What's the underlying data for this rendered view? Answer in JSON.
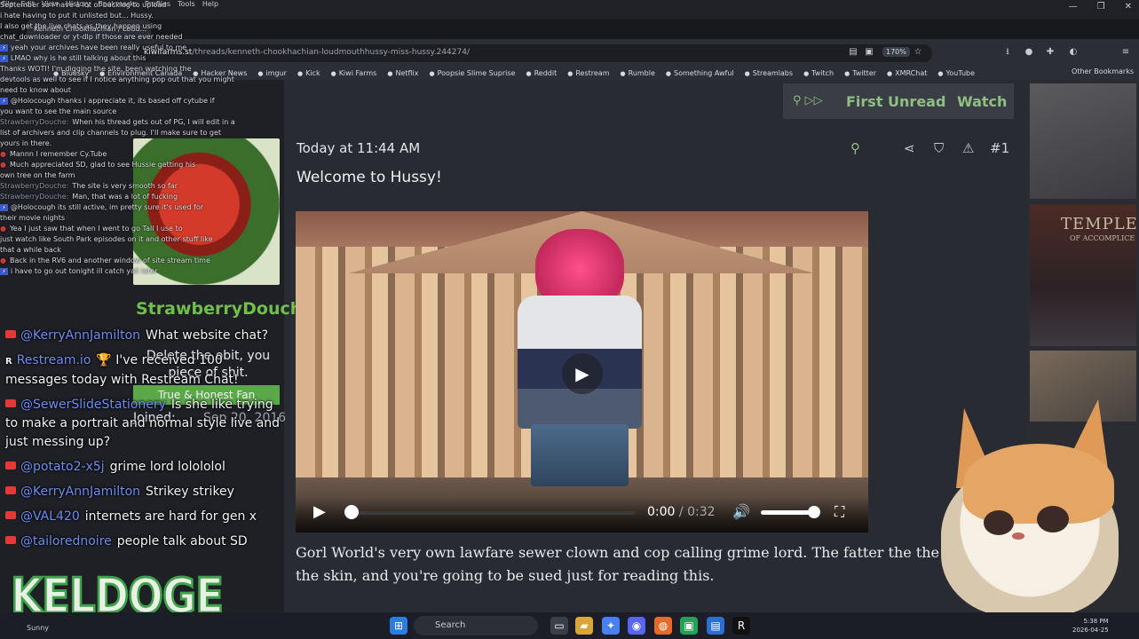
{
  "browser": {
    "menu": [
      "File",
      "Edit",
      "View",
      "History",
      "Bookmarks",
      "Profiles",
      "Tools",
      "Help"
    ],
    "tab_title": "Kenneth Chookhachian / Loud...",
    "url_host": "kiwifarms.st",
    "url_path": "/threads/kenneth-chookhachian-loudmouthhussy-miss-hussy.244274/",
    "zoom": "170%",
    "bookmarks": [
      "Bluesky",
      "Environment Canada",
      "Hacker News",
      "imgur",
      "Kick",
      "Kiwi Farms",
      "Netflix",
      "Poopsie Slime Suprise",
      "Reddit",
      "Restream",
      "Rumble",
      "Something Awful",
      "Streamlabs",
      "Twitch",
      "Twitter",
      "XMRChat",
      "YouTube"
    ],
    "other_bookmarks": "Other Bookmarks"
  },
  "thread_bar": {
    "first_unread": "First Unread",
    "watch": "Watch"
  },
  "post": {
    "username": "StrawberryDouche",
    "user_title": "Delete the obit, you piece of shit.",
    "badge": "True & Honest Fan",
    "joined_label": "Joined:",
    "joined_value": "Sep 20, 2016",
    "time": "Today at 11:44 AM",
    "number": "#1",
    "title": "Welcome to Hussy!",
    "body": "Gorl World's very own lawfare sewer clown and cop calling grime lord. The fatter the the thinner the skin, and you're going to be sued just for reading this."
  },
  "video": {
    "current": "0:00",
    "separator": "/",
    "duration": "0:32"
  },
  "chat_top": [
    {
      "who": "",
      "text": "September so i have a lot of backlog to upload"
    },
    {
      "who": "",
      "text": "i hate having to put it unlisted but... Hussy."
    },
    {
      "who": "",
      "text": "I also get the live chats as they happen using"
    },
    {
      "who": "",
      "text": "chat_downloader or yt-dlp if those are ever needed"
    },
    {
      "who": "mod",
      "text": "yeah your archives have been really useful to me"
    },
    {
      "who": "mod",
      "text": "LMAO why is he still talking about this"
    },
    {
      "who": "",
      "text": "Thanks WOTI! I'm digging the site, been watching the"
    },
    {
      "who": "",
      "text": "devtools as well to see if I notice anything pop out that you might"
    },
    {
      "who": "",
      "text": "need to know about"
    },
    {
      "who": "mod",
      "text": "@Holocough thanks i appreciate it, its based off cytube if"
    },
    {
      "who": "",
      "text": "you want to see the main source"
    },
    {
      "who": "StrawberryDouche:",
      "text": "When his thread gets out of PG, I will edit in a"
    },
    {
      "who": "",
      "text": "list of archivers and clip channels to plug. I'll make sure to get"
    },
    {
      "who": "",
      "text": "yours in there."
    },
    {
      "who": "red",
      "text": "Mannn I remember Cy.Tube"
    },
    {
      "who": "red",
      "text": "Much appreciated SD, glad to see Hussie getting his"
    },
    {
      "who": "",
      "text": "own tree on the farm"
    },
    {
      "who": "StrawberryDouche:",
      "text": "The site is very smooth so far"
    },
    {
      "who": "StrawberryDouche:",
      "text": "Man, that was a lot of fucking"
    },
    {
      "who": "mod",
      "text": "@Holocough its still active, im pretty sure it's used for"
    },
    {
      "who": "",
      "text": "their movie nights"
    },
    {
      "who": "red",
      "text": "Yea I just saw that when I went to go Tall I use to"
    },
    {
      "who": "",
      "text": "just watch like South Park episodes on it and other stuff like"
    },
    {
      "who": "",
      "text": "that a while back"
    },
    {
      "who": "red",
      "text": "Back in the RV6 and another window of site stream time"
    },
    {
      "who": "mod",
      "text": "i have to go out tonight ill catch yall later"
    }
  ],
  "chat_main": [
    {
      "src": "yt",
      "author": "@KerryAnnJamilton",
      "text": "What website chat?"
    },
    {
      "src": "rs",
      "author": "Restream.io",
      "text": "🏆 I've received 100 messages today with Restream Chat!"
    },
    {
      "src": "yt",
      "author": "@SewerSlideStationery",
      "text": "Is she like trying to make a portrait and normal style live and just messing up?"
    },
    {
      "src": "yt",
      "author": "@potato2-x5j",
      "text": "grime lord lolololol"
    },
    {
      "src": "yt",
      "author": "@KerryAnnJamilton",
      "text": "Strikey strikey"
    },
    {
      "src": "yt",
      "author": "@VAL420",
      "text": "internets are hard for gen x"
    },
    {
      "src": "yt",
      "author": "@tailorednoire",
      "text": "people talk about SD"
    }
  ],
  "overlay_brand": "KELDOGE",
  "right_art": {
    "title": "TEMPLE",
    "subtitle": "OF ACCOMPLICE"
  },
  "taskbar": {
    "weather": "Sunny",
    "search": "Search",
    "time": "5:38 PM",
    "date": "2026-04-25"
  }
}
